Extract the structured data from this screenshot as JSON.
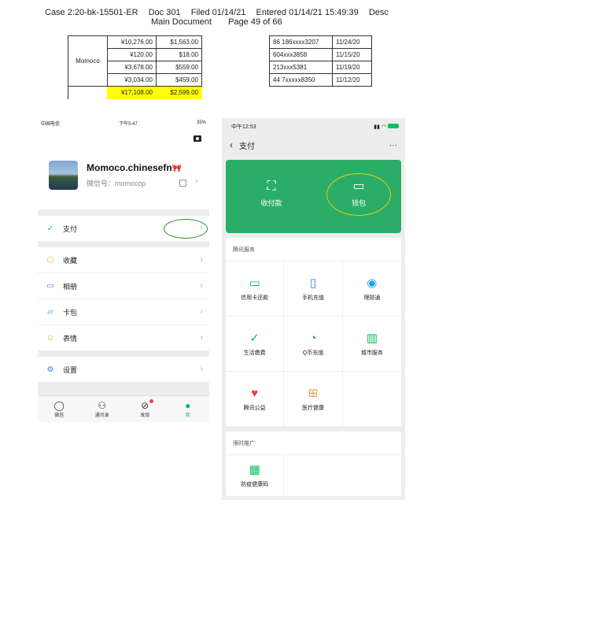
{
  "header": {
    "case": "Case 2:20-bk-15501-ER",
    "doc": "Doc 301",
    "filed": "Filed 01/14/21",
    "entered": "Entered 01/14/21 15:49:39",
    "desc": "Desc",
    "main": "Main Document",
    "page": "Page 49 of 66"
  },
  "ledger": {
    "name": "Momoco",
    "rows": [
      {
        "rmb": "¥10,276.00",
        "usd": "$1,563.00"
      },
      {
        "rmb": "¥120.00",
        "usd": "$18.00"
      },
      {
        "rmb": "¥3,678.00",
        "usd": "$559.00"
      },
      {
        "rmb": "¥3,034.00",
        "usd": "$459.00"
      }
    ],
    "total_rmb": "¥17,108.00",
    "total_usd": "$2,599.00"
  },
  "accounts": [
    {
      "num": "86 186xxxx3207",
      "date": "11/24/20"
    },
    {
      "num": "604xxx3858",
      "date": "11/15/20"
    },
    {
      "num": "213xxx5381",
      "date": "11/19/20"
    },
    {
      "num": "44 7xxxxx8350",
      "date": "11/12/20"
    }
  ],
  "phone_left": {
    "carrier": "中国电信",
    "time": "下午5:47",
    "battery": "35%",
    "profile_name": "Momoco.chinesefn",
    "profile_emoji": "🎀",
    "wechat_id": "微信号：momocop",
    "menu": [
      {
        "label": "支付",
        "icon": "pay-icon"
      },
      {
        "label": "收藏",
        "icon": "favorites-icon"
      },
      {
        "label": "相册",
        "icon": "album-icon"
      },
      {
        "label": "卡包",
        "icon": "cards-icon"
      },
      {
        "label": "表情",
        "icon": "sticker-icon"
      },
      {
        "label": "设置",
        "icon": "settings-icon"
      }
    ],
    "tabs": [
      "微信",
      "通讯录",
      "发现",
      "我"
    ]
  },
  "phone_right": {
    "time": "中午12:53",
    "title": "支付",
    "more": "···",
    "green_buttons": [
      "收付款",
      "钱包"
    ],
    "section1_title": "腾讯服务",
    "services": [
      "信用卡还款",
      "手机充值",
      "理财通",
      "生活缴费",
      "Q币充值",
      "城市服务",
      "腾讯公益",
      "医疗健康"
    ],
    "section2_title": "限时推广",
    "promos": [
      "防疫健康码"
    ]
  },
  "colors": {
    "wechat_green": "#07c160",
    "pay_green": "#2aae67",
    "highlight": "#ffff00",
    "oval_yellow": "#f5c518"
  }
}
